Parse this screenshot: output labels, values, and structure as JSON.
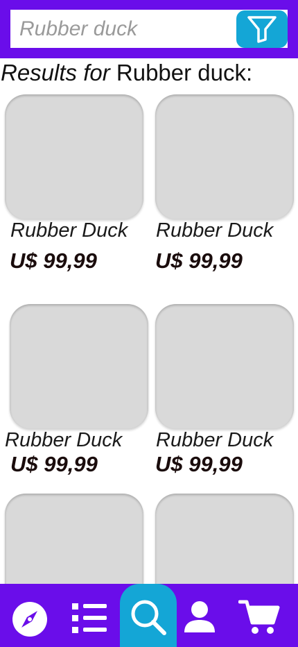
{
  "search": {
    "placeholder": "Rubber duck",
    "filter_icon": "filter-funnel-icon"
  },
  "results": {
    "prefix": "Results for ",
    "query": "Rubber duck:"
  },
  "products": [
    {
      "name": "Rubber Duck",
      "price": "U$ 99,99"
    },
    {
      "name": "Rubber Duck",
      "price": "U$ 99,99"
    },
    {
      "name": "Rubber Duck",
      "price": "U$ 99,99"
    },
    {
      "name": "Rubber Duck",
      "price": "U$ 99,99"
    },
    {
      "name": "",
      "price": ""
    },
    {
      "name": "",
      "price": ""
    }
  ],
  "bottom_nav": {
    "items": [
      {
        "icon": "compass-icon"
      },
      {
        "icon": "list-icon"
      },
      {
        "icon": "search-icon",
        "active": true
      },
      {
        "icon": "profile-icon"
      },
      {
        "icon": "cart-icon"
      }
    ]
  },
  "colors": {
    "brand_purple": "#6a0dea",
    "accent_blue": "#14a6d6",
    "placeholder_gray": "#d9d9d9"
  }
}
